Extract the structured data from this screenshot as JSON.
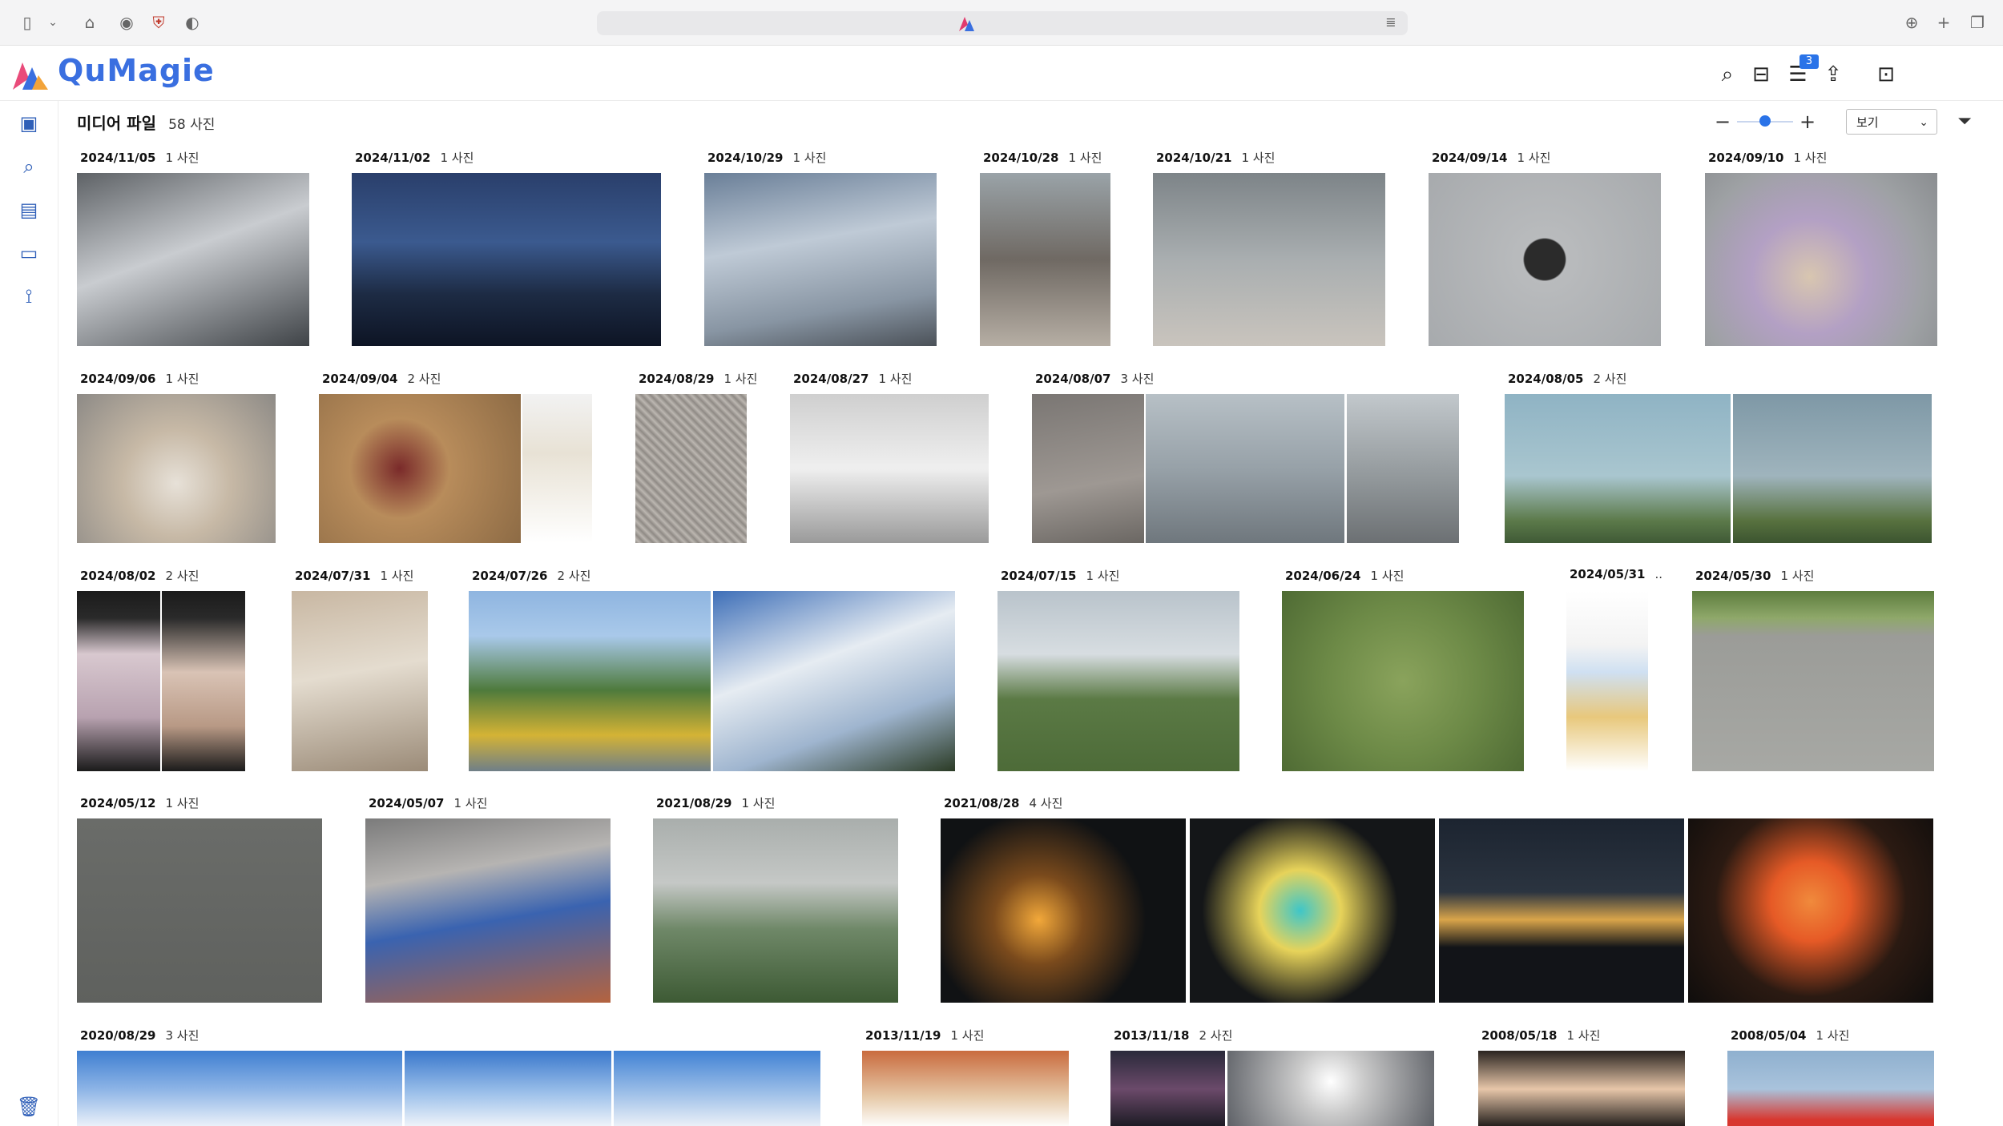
{
  "app": {
    "name": "QuMagie"
  },
  "header": {
    "notification_count": "3"
  },
  "page": {
    "title": "미디어 파일",
    "count": "58 사진"
  },
  "toolbar": {
    "view_label": "보기"
  },
  "groups": [
    {
      "date": "2024/11/05",
      "count": "1 사진",
      "photos": [
        {
          "bg": "linear-gradient(160deg,#5e6266 0%,#c9ccd0 45%,#3f4347 100%)"
        }
      ]
    },
    {
      "date": "2024/11/02",
      "count": "1 사진",
      "photos": [
        {
          "bg": "linear-gradient(180deg,#2a3f6b 0%,#3b5a8f 40%,#1d2b44 70%,#0d1424 100%)"
        }
      ]
    },
    {
      "date": "2024/10/29",
      "count": "1 사진",
      "photos": [
        {
          "bg": "linear-gradient(170deg,#6a7f98 0%,#bfcad6 40%,#8895a3 75%,#4b5158 100%)"
        }
      ]
    },
    {
      "date": "2024/10/28",
      "count": "1 사진",
      "photos": [
        {
          "bg": "linear-gradient(180deg,#9aa3a8 0%,#6f6963 50%,#b6aea4 100%)"
        }
      ]
    },
    {
      "date": "2024/10/21",
      "count": "1 사진",
      "photos": [
        {
          "bg": "linear-gradient(180deg,#7d8488 0%,#a9aeb0 50%,#c9c4bd 100%)"
        }
      ]
    },
    {
      "date": "2024/09/14",
      "count": "1 사진",
      "photos": [
        {
          "bg": "radial-gradient(circle at 50% 50%,#2b2b2b 0%,#2b2b2b 14%,#b9bbbd 15%,#a7aaad 100%)"
        }
      ]
    },
    {
      "date": "2024/09/10",
      "count": "1 사진",
      "photos": [
        {
          "bg": "radial-gradient(circle at 45% 60%,#d8c6b0 0%,#b3a0c4 35%,#9ea1a4 70%,#8a8d90 100%)"
        }
      ]
    },
    {
      "date": "2024/09/06",
      "count": "1 사진",
      "photos": [
        {
          "bg": "radial-gradient(circle at 50% 60%,#e7e1d8 0%,#c7b9a6 40%,#8d8a86 100%)"
        }
      ]
    },
    {
      "date": "2024/09/04",
      "count": "2 사진",
      "photos": [
        {
          "bg": "radial-gradient(circle at 40% 50%,#7a2a2a 0%,#b88c5b 35%,#8d6b45 100%)"
        },
        {
          "bg": "linear-gradient(180deg,#f2f2f2 0%,#e8e2d5 40%,#ffffff 100%)"
        }
      ]
    },
    {
      "date": "2024/08/29",
      "count": "1 사진",
      "photos": [
        {
          "bg": "repeating-linear-gradient(45deg,#8f8a85 0px,#bcb7b1 4px,#8f8a85 8px)"
        }
      ]
    },
    {
      "date": "2024/08/27",
      "count": "1 사진",
      "photos": [
        {
          "bg": "linear-gradient(180deg,#cfcfcf 0%,#efefef 50%,#9a9a9a 100%)"
        }
      ]
    },
    {
      "date": "2024/08/07",
      "count": "3 사진",
      "photos": [
        {
          "bg": "linear-gradient(170deg,#7a7673 0%,#9e9893 60%,#6b6763 100%)"
        },
        {
          "bg": "linear-gradient(180deg,#b7c0c6 0%,#97a1a8 50%,#6f777d 100%)"
        },
        {
          "bg": "linear-gradient(180deg,#c2c8cc 0%,#8f9598 60%,#6c7073 100%)"
        }
      ]
    },
    {
      "date": "2024/08/05",
      "count": "2 사진",
      "photos": [
        {
          "bg": "linear-gradient(180deg,#8fb3c4 0%,#a9c6cf 55%,#5c7a4a 85%,#3f5a36 100%)"
        },
        {
          "bg": "linear-gradient(180deg,#7e98a6 0%,#9fb4bd 55%,#58723f 85%,#3c5430 100%)"
        }
      ]
    },
    {
      "date": "2024/08/02",
      "count": "2 사진",
      "photos": [
        {
          "bg": "linear-gradient(180deg,#1b1b1b 0%,#2a2a2a 15%,#d8c8cf 35%,#b8a2b0 70%,#1b1b1b 100%)"
        },
        {
          "bg": "linear-gradient(180deg,#1b1b1b 0%,#2a2a2a 15%,#d9c3b5 45%,#b89985 75%,#1b1b1b 100%)"
        }
      ]
    },
    {
      "date": "2024/07/31",
      "count": "1 사진",
      "photos": [
        {
          "bg": "linear-gradient(170deg,#c8b7a2 0%,#e4dccf 45%,#9b8b78 100%)"
        }
      ]
    },
    {
      "date": "2024/07/26",
      "count": "2 사진",
      "photos": [
        {
          "bg": "linear-gradient(180deg,#8fb5e0 0%,#a9c9ea 25%,#4e7a3c 55%,#d4b335 80%,#6f7f88 100%)"
        },
        {
          "bg": "linear-gradient(160deg,#3e6fb8 0%,#e6ecf2 40%,#9fb5cf 70%,#2b3b25 100%)"
        }
      ]
    },
    {
      "date": "2024/07/15",
      "count": "1 사진",
      "photos": [
        {
          "bg": "linear-gradient(180deg,#b9c3cb 0%,#d7dde1 35%,#5b7a45 60%,#4d6b38 100%)"
        }
      ]
    },
    {
      "date": "2024/06/24",
      "count": "1 사진",
      "photos": [
        {
          "bg": "radial-gradient(circle at 50% 50%,#8aa35c 0%,#6d8a47 50%,#4f6b34 100%)"
        }
      ]
    },
    {
      "date": "2024/05/31",
      "count": "..",
      "photos": [
        {
          "bg": "linear-gradient(180deg,#ffffff 0%,#f3f3f3 30%,#cfe0f2 45%,#e8c87c 70%,#ffffff 100%)"
        }
      ]
    },
    {
      "date": "2024/05/30",
      "count": "1 사진",
      "photos": [
        {
          "bg": "linear-gradient(180deg,#5d7d3e 0%,#8fa86a 15%,#9b9c98 25%,#a7a8a4 100%)"
        }
      ]
    },
    {
      "date": "2024/05/12",
      "count": "1 사진",
      "photos": [
        {
          "bg": "linear-gradient(180deg,#6a6c69 0%,#5f615e 100%)"
        }
      ]
    },
    {
      "date": "2024/05/07",
      "count": "1 사진",
      "photos": [
        {
          "bg": "linear-gradient(170deg,#7b7b7b 0%,#b6b4b2 30%,#3a63b0 55%,#b4633f 100%)"
        }
      ]
    },
    {
      "date": "2021/08/29",
      "count": "1 사진",
      "photos": [
        {
          "bg": "linear-gradient(180deg,#a9aeac 0%,#c5c8c6 35%,#6f8868 60%,#3d5a34 100%)"
        }
      ]
    },
    {
      "date": "2021/08/28",
      "count": "4 사진",
      "photos": [
        {
          "bg": "radial-gradient(circle at 40% 55%,#f2a83a 0%,#7a4a1c 25%,#101214 60%)"
        },
        {
          "bg": "radial-gradient(circle at 45% 50%,#3ec6c9 0%,#e7d35a 25%,#141618 60%)"
        },
        {
          "bg": "linear-gradient(180deg,#1c2430 0%,#2b3440 40%,#d9a54a 55%,#121418 70%)"
        },
        {
          "bg": "radial-gradient(circle at 50% 45%,#f08a3c 0%,#e65a26 25%,#2b1a12 60%,#0f0d0c 100%)"
        }
      ]
    },
    {
      "date": "2020/08/29",
      "count": "3 사진",
      "photos": [
        {
          "bg": "linear-gradient(180deg,#3f7fd1 0%,#8db4e6 50%,#eef3fa 100%)"
        },
        {
          "bg": "linear-gradient(180deg,#3a78cc 0%,#9cc0ea 55%,#f2f5fa 100%)"
        },
        {
          "bg": "linear-gradient(180deg,#4182d4 0%,#9dbfe8 55%,#eef2f8 100%)"
        }
      ]
    },
    {
      "date": "2013/11/19",
      "count": "1 사진",
      "photos": [
        {
          "bg": "linear-gradient(180deg,#c96b3e 0%,#e6c9a8 60%,#ffffff 100%)"
        }
      ]
    },
    {
      "date": "2013/11/18",
      "count": "2 사진",
      "photos": [
        {
          "bg": "linear-gradient(180deg,#2a2a3a 0%,#6b4a6a 50%,#1a1a22 100%)"
        },
        {
          "bg": "radial-gradient(circle at 50% 40%,#ffffff 0%,#c9c9c9 30%,#5d6066 100%)"
        }
      ]
    },
    {
      "date": "2008/05/18",
      "count": "1 사진",
      "photos": [
        {
          "bg": "linear-gradient(180deg,#2a2420 0%,#e7c6a9 50%,#1e1a17 100%)"
        }
      ]
    },
    {
      "date": "2008/05/04",
      "count": "1 사진",
      "photos": [
        {
          "bg": "linear-gradient(180deg,#8fb0cf 0%,#a9c3dc 50%,#d8372f 90%)"
        }
      ]
    }
  ]
}
